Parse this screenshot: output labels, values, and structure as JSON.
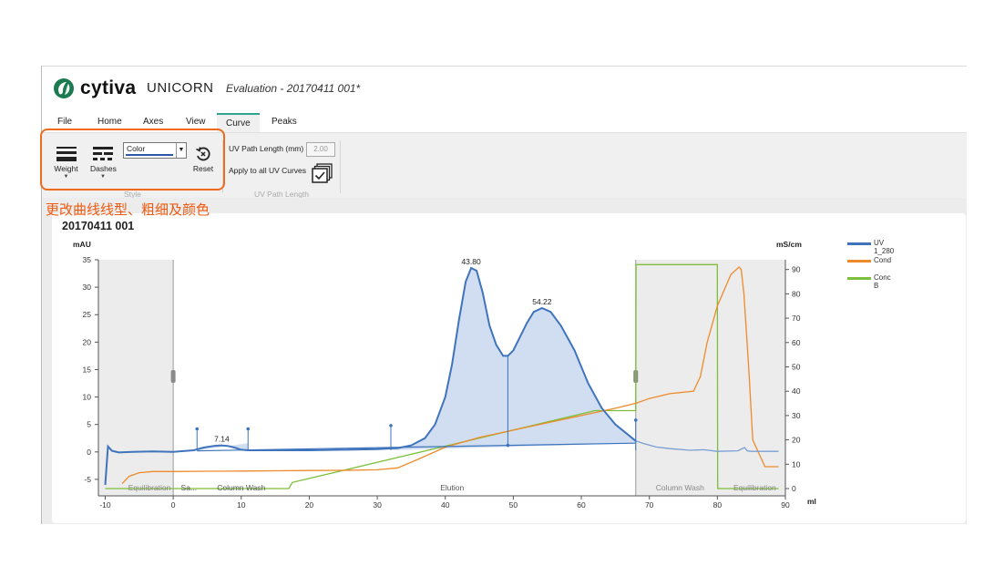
{
  "app": {
    "brand": "cytiva",
    "name": "UNICORN",
    "document_title": "Evaluation - 20170411 001*"
  },
  "menu": [
    {
      "label": "File"
    },
    {
      "label": "Home"
    },
    {
      "label": "Axes"
    },
    {
      "label": "View"
    },
    {
      "label": "Curve",
      "active": true
    },
    {
      "label": "Peaks"
    }
  ],
  "ribbon": {
    "weight_label": "Weight",
    "dashes_label": "Dashes",
    "color_value": "Color",
    "reset_label": "Reset",
    "style_group": "Style",
    "uv_path_label": "UV Path Length (mm)",
    "uv_path_value": "2.00",
    "apply_label": "Apply to all UV Curves",
    "uv_group": "UV Path Length"
  },
  "annotation": {
    "text": "更改曲线线型、粗细及颜色",
    "color": "#ee6a1c"
  },
  "chart_title": "20170411 001",
  "chart_data": {
    "type": "line",
    "left_axis": {
      "unit": "mAU",
      "range": [
        -8,
        35
      ],
      "ticks": [
        -5,
        0,
        5,
        10,
        15,
        20,
        25,
        30,
        35
      ]
    },
    "right_axis": {
      "unit": "mS/cm",
      "range": [
        -3,
        94
      ],
      "ticks": [
        0,
        10,
        20,
        30,
        40,
        50,
        60,
        70,
        80,
        90
      ]
    },
    "x_axis": {
      "unit": "ml",
      "range": [
        -11,
        90
      ],
      "ticks": [
        -10,
        0,
        10,
        20,
        30,
        40,
        50,
        60,
        70,
        80,
        90
      ]
    },
    "series": [
      {
        "name": "UV 1_280",
        "color": "#3f74bd",
        "axis": "left",
        "x": [
          -10,
          -9.6,
          -9,
          -8,
          -6,
          -3,
          0,
          3,
          4.5,
          6,
          7,
          8,
          9,
          10,
          11,
          15,
          20,
          25,
          30,
          33,
          35,
          37,
          38.5,
          40,
          41,
          42,
          43,
          43.8,
          44.6,
          45.5,
          46.5,
          47.5,
          48.5,
          49.2,
          50,
          51,
          52,
          53,
          54.22,
          55.5,
          57,
          59,
          61,
          63,
          65,
          67,
          68,
          69,
          71,
          73,
          76,
          78,
          80,
          83,
          84,
          84.4,
          85,
          86,
          89
        ],
        "y": [
          -6,
          1,
          0.2,
          -0.1,
          0,
          0.1,
          0,
          0.3,
          0.8,
          1.1,
          1.2,
          1.1,
          0.8,
          0.4,
          0.3,
          0.3,
          0.3,
          0.4,
          0.5,
          0.7,
          1.2,
          2.5,
          5,
          10,
          16,
          24,
          31,
          33.5,
          33,
          29,
          23,
          19.5,
          17.5,
          17.5,
          18.5,
          21,
          23.5,
          25.5,
          26.2,
          25.5,
          23,
          18.5,
          12.5,
          8,
          5,
          3,
          2,
          1.6,
          0.9,
          0.6,
          0.3,
          0.4,
          0.1,
          0.2,
          0.8,
          0.2,
          0.1,
          0.1,
          0.1
        ]
      },
      {
        "name": "Cond",
        "color": "#ee8a2a",
        "axis": "right",
        "x": [
          -7.5,
          -6.5,
          -5,
          -3,
          0,
          5,
          10,
          15,
          20,
          25,
          30,
          33,
          36,
          40,
          45,
          50,
          55,
          60,
          65,
          68,
          70,
          73,
          76.5,
          77.5,
          78.5,
          80,
          82,
          83.2,
          83.5,
          83.9,
          84.6,
          85.2,
          87,
          89
        ],
        "y": [
          2,
          5,
          6.5,
          7,
          7,
          7.1,
          7.2,
          7.3,
          7.4,
          7.5,
          7.7,
          8.5,
          12,
          17,
          21,
          24,
          27,
          30,
          33,
          35,
          37,
          39,
          40,
          46,
          60,
          75,
          88,
          91,
          90,
          80,
          50,
          20,
          9,
          9
        ]
      },
      {
        "name": "Conc B",
        "color": "#7cbf3a",
        "axis": "right",
        "x": [
          -10,
          17,
          17.5,
          62,
          62.5,
          68,
          68.05,
          80,
          80.05,
          89
        ],
        "y": [
          0,
          0,
          2.5,
          32,
          32,
          32,
          92,
          92,
          0,
          0
        ]
      }
    ],
    "peaks": [
      {
        "label": "43.80",
        "x": 43.8,
        "y": 33.5
      },
      {
        "label": "54.22",
        "x": 54.22,
        "y": 26.2
      },
      {
        "label": "7.14",
        "x": 7.14,
        "y": 1.2
      }
    ],
    "segments": [
      "Equilibration",
      "Sa...",
      "Column Wash",
      "Elution",
      "Column Wash",
      "Equilibration"
    ],
    "legend": [
      "UV 1_280",
      "Cond",
      "Conc B"
    ]
  }
}
